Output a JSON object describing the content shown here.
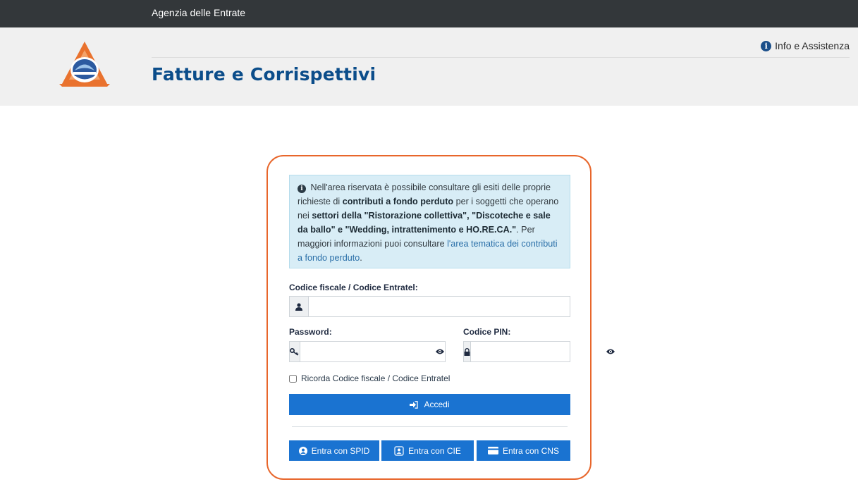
{
  "topbar": {
    "brand": "Agenzia delle Entrate"
  },
  "header": {
    "title": "Fatture e Corrispettivi",
    "info_link": "Info e Assistenza"
  },
  "notice": {
    "p1": "Nell'area riservata è possibile consultare gli esiti delle proprie richieste di ",
    "b1": "contributi a fondo perduto",
    "p2": " per i soggetti che operano nei ",
    "b2": "settori della \"Ristorazione collettiva\", \"Discoteche e sale da ballo\" e \"Wedding, intrattenimento e HO.RE.CA.\"",
    "p3": ". Per maggiori informazioni puoi consultare ",
    "link": "l'area tematica dei contributi a fondo perduto",
    "p4": "."
  },
  "form": {
    "codice_label": "Codice fiscale / Codice Entratel:",
    "password_label": "Password:",
    "pin_label": "Codice PIN:",
    "remember_label": "Ricorda Codice fiscale / Codice Entratel",
    "submit_label": "Accedi"
  },
  "alt_login": {
    "spid": "Entra con SPID",
    "cie": "Entra con CIE",
    "cns": "Entra con CNS"
  },
  "colors": {
    "accent": "#1a73d1",
    "card_border": "#e8662b",
    "title": "#0b4d8a",
    "topbar": "#33373a"
  }
}
